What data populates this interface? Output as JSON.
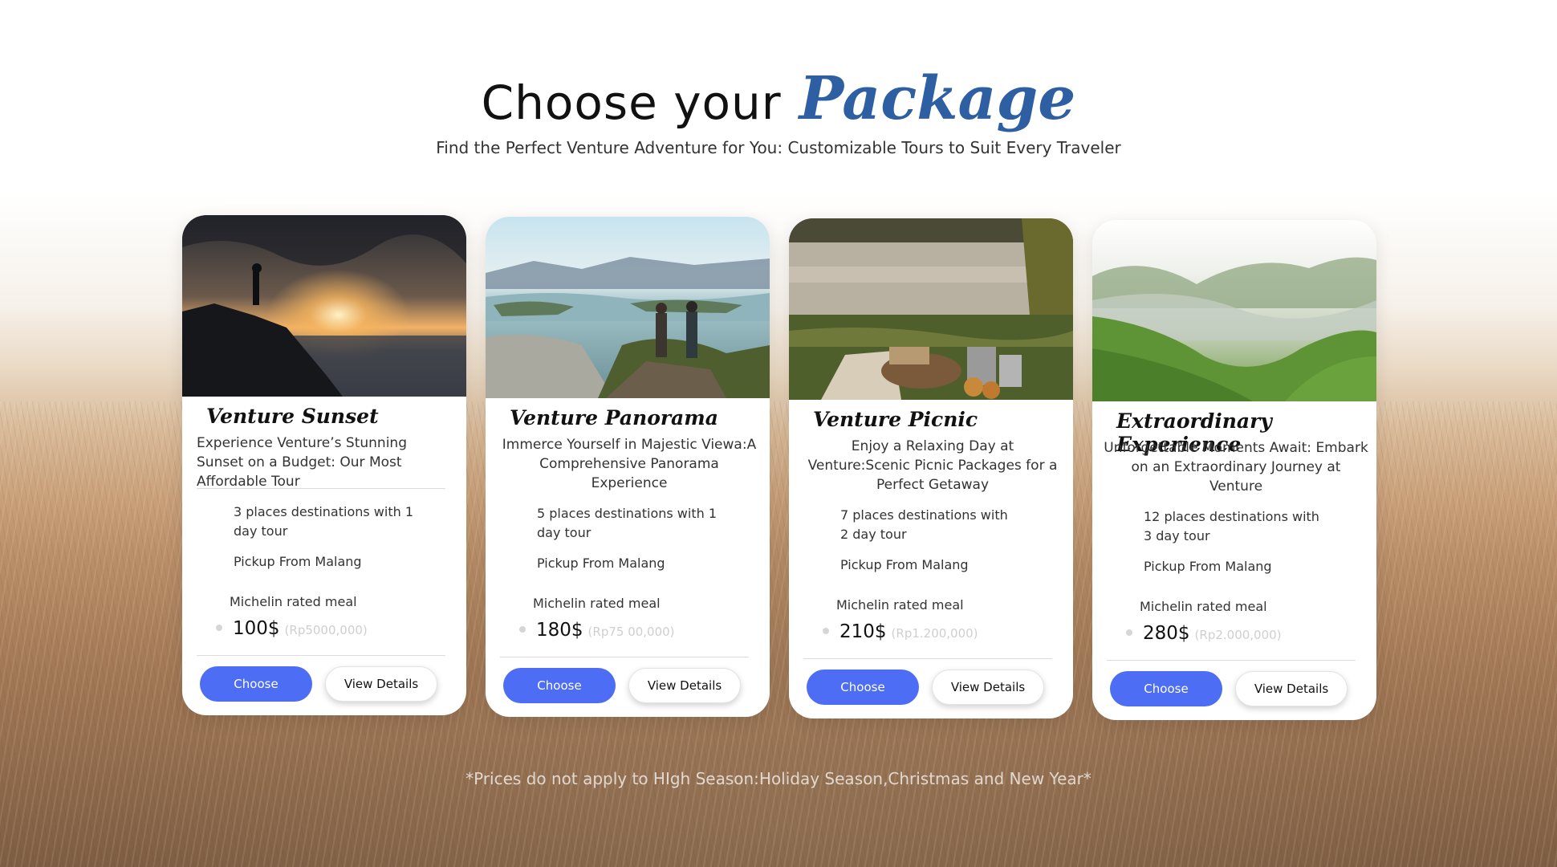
{
  "header": {
    "title_main": "Choose your",
    "title_accent": "Package",
    "subtitle": "Find the Perfect Venture Adventure for You: Customizable Tours to Suit  Every Traveler"
  },
  "colors": {
    "accent": "#2f5fa3",
    "button": "#4d6df4"
  },
  "cards": [
    {
      "name": "Venture Sunset",
      "description": "Experience Venture’s Stunning Sunset on a Budget: Our Most Affordable Tour",
      "feature_1": "3 places destinations with 1 day tour",
      "feature_2": "Pickup From Malang",
      "feature_3": "Michelin rated meal",
      "price": "100$",
      "price_idr": "(Rp5000,000)",
      "choose_label": "Choose",
      "details_label": "View Details",
      "image": "sunset-cliff-photo"
    },
    {
      "name": "Venture Panorama",
      "description": "Immerce Yourself in Majestic Viewa:A Comprehensive Panorama Experience",
      "feature_1": "5 places destinations with 1 day tour",
      "feature_2": "Pickup From Malang",
      "feature_3": "Michelin rated meal",
      "price": "180$",
      "price_idr": "(Rp75 00,000)",
      "choose_label": "Choose",
      "details_label": "View Details",
      "image": "hikers-panorama-photo"
    },
    {
      "name": "Venture Picnic",
      "description": "Enjoy a Relaxing Day at Venture:Scenic Picnic Packages for a Perfect Getaway",
      "feature_1": "7 places destinations with 2 day tour",
      "feature_2": "Pickup From Malang",
      "feature_3": "Michelin rated meal",
      "price": "210$",
      "price_idr": "(Rp1.200,000)",
      "choose_label": "Choose",
      "details_label": "View Details",
      "image": "lakeside-picnic-photo"
    },
    {
      "name": "Extraordinary Experience",
      "description": "Unforgettable Moments Await: Embark on an Extraordinary Journey at Venture",
      "feature_1": "12 places destinations with 3 day tour",
      "feature_2": "Pickup From Malang",
      "feature_3": "Michelin rated meal",
      "price": "280$",
      "price_idr": "(Rp2.000,000)",
      "choose_label": "Choose",
      "details_label": "View Details",
      "image": "green-valley-photo"
    }
  ],
  "footer_note": "*Prices do not apply to HIgh Season:Holiday Season,Christmas and New Year*"
}
